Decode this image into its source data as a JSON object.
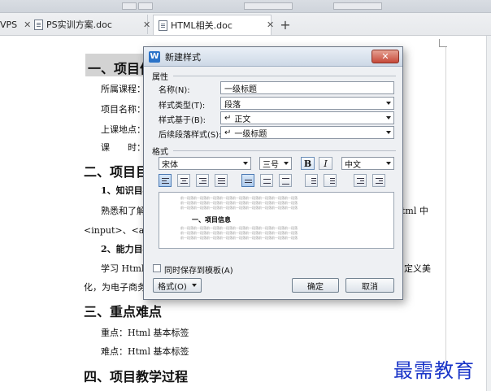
{
  "tabs": [
    {
      "label": "VPS",
      "close": "✕"
    },
    {
      "label": "PS实训方案.doc",
      "close": "✕"
    },
    {
      "label": "HTML相关.doc",
      "close": "✕"
    }
  ],
  "tab_add": "+",
  "document": {
    "h1_1": "一、项目信",
    "lines": [
      "所属课程：",
      "项目名称：",
      "上课地点：",
      "课　　时："
    ],
    "h1_2": "二、项目目",
    "h2_1": "1、知识目标",
    "p1_left": "熟悉和了解",
    "p1_right": "tml 中",
    "p2": "<input>、<a>等",
    "h2_2": "2、能力目标",
    "p3_left": "学习 Html 的",
    "p3_right": "定义美",
    "p4": "化，为电子商务",
    "h1_3": "三、重点难点",
    "key_point": "重点：Html 基本标签",
    "hard_point": "难点：Html 基本标签",
    "h1_4": "四、项目教学过程"
  },
  "dialog": {
    "app_icon": "W",
    "title": "新建样式",
    "close": "✕",
    "section_properties": "属性",
    "name_label": "名称(N):",
    "name_value": "一级标题",
    "style_type_label": "样式类型(T):",
    "style_type_value": "段落",
    "based_on_label": "样式基于(B):",
    "based_on_value": "正文",
    "next_style_label": "后续段落样式(S):",
    "next_style_value": "一级标题",
    "section_format": "格式",
    "font": "宋体",
    "size": "三号",
    "bold": "B",
    "italic": "I",
    "lang": "中文",
    "preview_heading": "一、项目信息",
    "preview_filler": "前一段落前一段落前一段落前一段落前一段落前一段落前一段落前一段落前一段落",
    "save_to_template": "同时保存到模板(A)",
    "format_button": "格式(O)",
    "ok_button": "确定",
    "cancel_button": "取消"
  },
  "watermark": "最需教育"
}
